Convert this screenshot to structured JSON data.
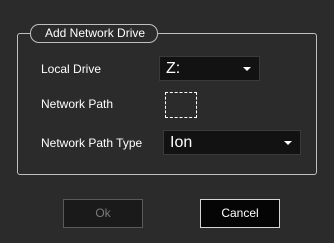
{
  "dialog": {
    "group_title": "Add Network Drive",
    "local_drive": {
      "label": "Local Drive",
      "value": "Z:"
    },
    "network_path": {
      "label": "Network Path",
      "value": ""
    },
    "network_path_type": {
      "label": "Network Path Type",
      "value": "Ion"
    },
    "buttons": {
      "ok_label": "Ok",
      "ok_enabled": false,
      "cancel_label": "Cancel"
    }
  },
  "colors": {
    "background": "#2b2b2b",
    "field_background": "#121212",
    "frame_border": "#bfbfbf",
    "text": "#ffffff",
    "disabled_text": "#7a7a7a"
  },
  "icons": {
    "combo_arrow": "chevron-down-icon"
  }
}
